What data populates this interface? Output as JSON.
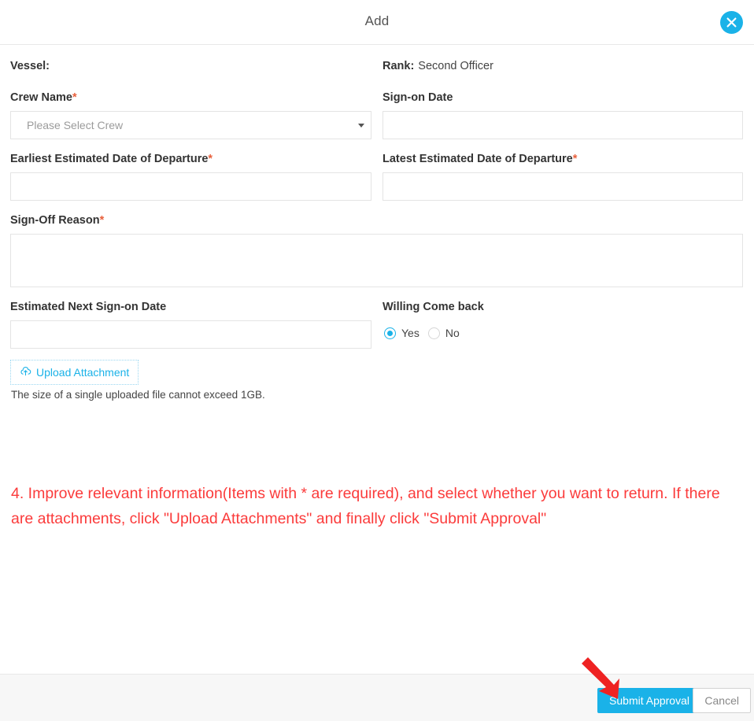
{
  "header": {
    "title": "Add",
    "close_icon": "close-x-icon"
  },
  "form": {
    "vessel": {
      "label": "Vessel:",
      "value": ""
    },
    "rank": {
      "label": "Rank:",
      "value": "Second Officer"
    },
    "crew_name": {
      "label": "Crew Name",
      "required": "*",
      "placeholder": "Please Select Crew",
      "value": "Please Select Crew",
      "caret_icon": "chevron-down-icon"
    },
    "sign_on_date": {
      "label": "Sign-on Date",
      "value": "",
      "placeholder": ""
    },
    "earliest_etd": {
      "label": "Earliest Estimated Date of Departure",
      "required": "*",
      "value": "",
      "placeholder": ""
    },
    "latest_etd": {
      "label": "Latest Estimated Date of Departure",
      "required": "*",
      "value": "",
      "placeholder": ""
    },
    "sign_off_reason": {
      "label": "Sign-Off Reason",
      "required": "*",
      "value": "",
      "placeholder": ""
    },
    "estimated_next_sign_on": {
      "label": "Estimated Next Sign-on Date",
      "value": "",
      "placeholder": ""
    },
    "willing_come_back": {
      "label": "Willing Come back",
      "selected": "Yes",
      "options": [
        "Yes",
        "No"
      ]
    },
    "upload": {
      "button_label": "Upload Attachment",
      "icon": "cloud-upload-icon",
      "hint": "The size of a single uploaded file cannot exceed 1GB."
    }
  },
  "annotation": {
    "text": "4. Improve relevant information(Items with * are required), and select whether you want to return. If there are attachments, click \"Upload Attachments\" and finally click \"Submit Approval\"",
    "color": "#fb3b3b",
    "arrow_icon": "red-arrow-pointing-to-submit"
  },
  "footer": {
    "submit_label": "Submit Approval",
    "cancel_label": "Cancel"
  },
  "colors": {
    "accent": "#1ab2e8",
    "required_star": "#e8603c",
    "annotation_red": "#fb3b3b",
    "footer_bg": "#f7f7f7",
    "border": "#e4e4e4"
  }
}
